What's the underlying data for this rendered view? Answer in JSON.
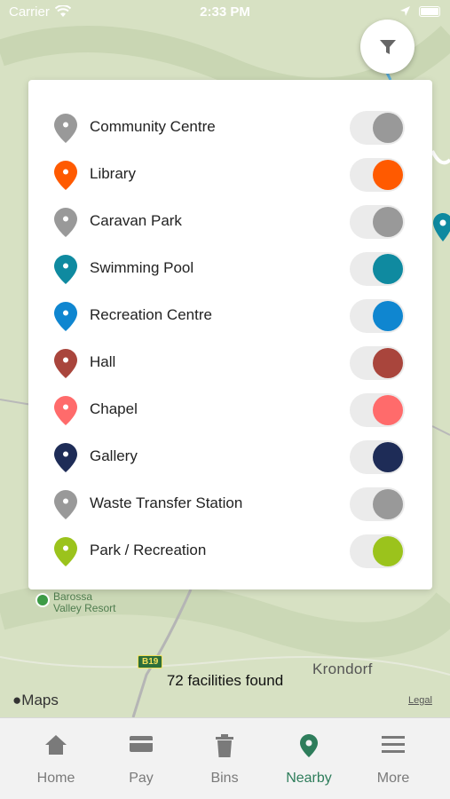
{
  "status_bar": {
    "carrier": "Carrier",
    "time": "2:33 PM"
  },
  "map": {
    "place_label": "Krondorf",
    "resort_label_line1": "Barossa",
    "resort_label_line2": "Valley Resort",
    "road_shield": "B19",
    "facilities_found": "72 facilities found",
    "maps_logo": "Maps",
    "legal": "Legal"
  },
  "filter_button": {
    "icon": "filter-icon"
  },
  "filters": [
    {
      "label": "Community Centre",
      "color": "#999999"
    },
    {
      "label": "Library",
      "color": "#ff5a00"
    },
    {
      "label": "Caravan Park",
      "color": "#999999"
    },
    {
      "label": "Swimming Pool",
      "color": "#0f8aa0"
    },
    {
      "label": "Recreation Centre",
      "color": "#0f86d0"
    },
    {
      "label": "Hall",
      "color": "#a9453c"
    },
    {
      "label": "Chapel",
      "color": "#ff6b6b"
    },
    {
      "label": "Gallery",
      "color": "#1e2c57"
    },
    {
      "label": "Waste Transfer Station",
      "color": "#999999"
    },
    {
      "label": "Park / Recreation",
      "color": "#9bc31c"
    }
  ],
  "tabs": [
    {
      "label": "Home",
      "icon": "home-icon"
    },
    {
      "label": "Pay",
      "icon": "card-icon"
    },
    {
      "label": "Bins",
      "icon": "bin-icon"
    },
    {
      "label": "Nearby",
      "icon": "location-pin-icon",
      "active": true
    },
    {
      "label": "More",
      "icon": "menu-icon"
    }
  ],
  "colors": {
    "accent": "#2e7d5b",
    "inactive_tab": "#7a7a7a",
    "toggle_track": "#ebebeb"
  }
}
